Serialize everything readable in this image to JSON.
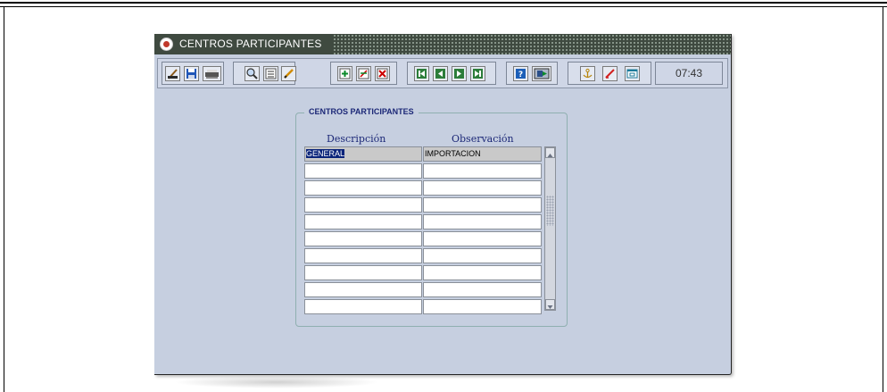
{
  "window": {
    "title": "CENTROS PARTICIPANTES"
  },
  "toolbar": {
    "buttons": [
      "clear-broom-icon",
      "save-disk-icon",
      "print-icon",
      "search-magnifier-icon",
      "list-icon",
      "edit-pencil-icon",
      "insert-record-icon",
      "duplicate-record-icon",
      "delete-record-icon",
      "first-record-icon",
      "previous-record-icon",
      "next-record-icon",
      "last-record-icon",
      "help-icon",
      "exit-icon",
      "anchor-icon",
      "red-check-icon",
      "calendar-icon"
    ],
    "clock": "07:43"
  },
  "form": {
    "frame_title": "CENTROS PARTICIPANTES",
    "columns": [
      "Descripción",
      "Observación"
    ],
    "rows": [
      {
        "descripcion": "GENERAL",
        "observacion": "IMPORTACION"
      },
      {
        "descripcion": "",
        "observacion": ""
      },
      {
        "descripcion": "",
        "observacion": ""
      },
      {
        "descripcion": "",
        "observacion": ""
      },
      {
        "descripcion": "",
        "observacion": ""
      },
      {
        "descripcion": "",
        "observacion": ""
      },
      {
        "descripcion": "",
        "observacion": ""
      },
      {
        "descripcion": "",
        "observacion": ""
      },
      {
        "descripcion": "",
        "observacion": ""
      },
      {
        "descripcion": "",
        "observacion": ""
      }
    ]
  },
  "colors": {
    "window_bg": "#c6cfe0",
    "title_bar": "#3f4a40",
    "label_text": "#1c2877",
    "selection": "#0a247a"
  }
}
